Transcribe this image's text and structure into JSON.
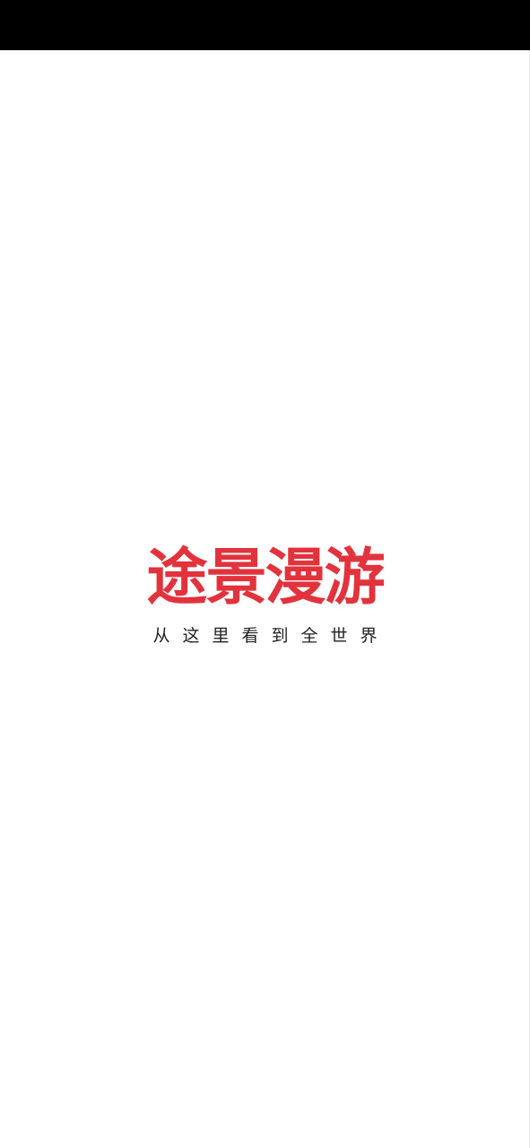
{
  "splash": {
    "app_name": "途景漫游",
    "tagline": "从这里看到全世界"
  },
  "colors": {
    "brand_red": "#e2333d",
    "status_bar": "#000000",
    "background": "#ffffff",
    "tagline_text": "#222222"
  }
}
